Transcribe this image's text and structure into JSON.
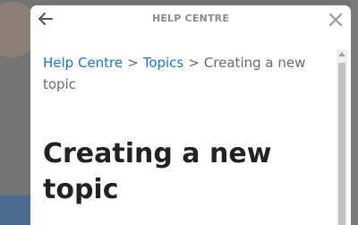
{
  "header": {
    "title": "HELP CENTRE",
    "back_icon": "arrow-left-icon",
    "close_icon": "close-icon"
  },
  "breadcrumb": {
    "items": [
      {
        "label": "Help Centre",
        "link": true
      },
      {
        "label": "Topics",
        "link": true
      },
      {
        "label": "Creating a new topic",
        "link": false
      }
    ],
    "separator": ">"
  },
  "article": {
    "title": "Creating a new topic"
  },
  "colors": {
    "link": "#1f73d2",
    "title": "#222222",
    "header_text": "#8a8a8a",
    "overlay": "#737373"
  }
}
